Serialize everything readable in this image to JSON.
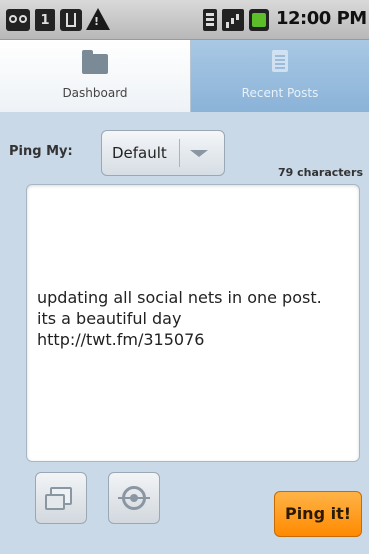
{
  "status_bar": {
    "time": "12:00 PM",
    "calendar_day": "1",
    "icons": [
      "voicemail-icon",
      "calendar-icon",
      "usb-icon",
      "warning-icon",
      "wifi-icon",
      "signal-icon",
      "battery-icon"
    ]
  },
  "tabs": [
    {
      "label": "Dashboard",
      "icon": "folder-icon",
      "selected": true
    },
    {
      "label": "Recent Posts",
      "icon": "list-icon",
      "selected": false
    }
  ],
  "compose": {
    "ping_label": "Ping My:",
    "ping_target": "Default",
    "char_count": "79 characters",
    "post_text": "updating all social nets in one post.  its a beautiful day http://twt.fm/315076"
  },
  "actions": {
    "gallery_icon": "gallery-icon",
    "location_icon": "location-icon",
    "ping_button_label": "Ping it!"
  },
  "colors": {
    "accent_orange": "#ff9a1f",
    "tab_selected_bg": "#ffffff",
    "tab_unselected_bg": "#9bbfe0",
    "background": "#c9d9e8"
  }
}
